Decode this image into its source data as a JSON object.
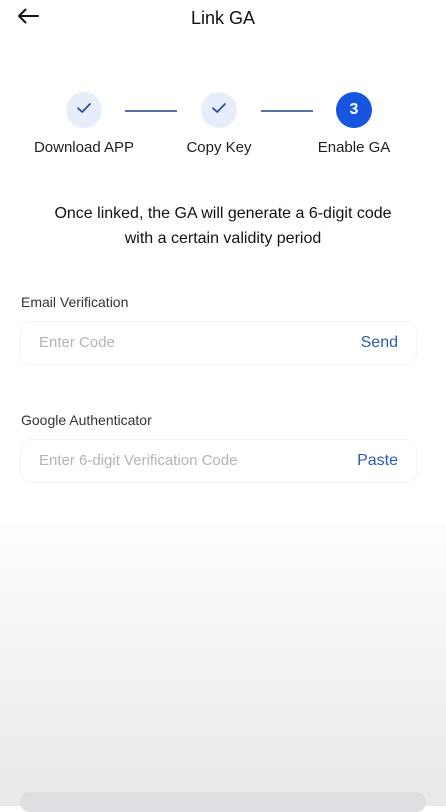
{
  "header": {
    "title": "Link GA",
    "back_icon": "arrow-left-icon"
  },
  "steps": [
    {
      "label": "Download APP",
      "status": "done",
      "icon": "check-icon"
    },
    {
      "label": "Copy Key",
      "status": "done",
      "icon": "check-icon"
    },
    {
      "label": "Enable GA",
      "status": "active",
      "number": "3"
    }
  ],
  "intro": {
    "line1": "Once linked, the GA will generate a 6-digit code",
    "line2": "with a certain validity period"
  },
  "email": {
    "label": "Email Verification",
    "placeholder": "Enter Code",
    "action": "Send"
  },
  "google": {
    "label": "Google Authenticator",
    "placeholder": "Enter 6-digit Verification Code",
    "action": "Paste"
  },
  "colors": {
    "accent": "#1754e0",
    "link": "#2a5bb8",
    "step_done_bg": "#e6eefb"
  }
}
